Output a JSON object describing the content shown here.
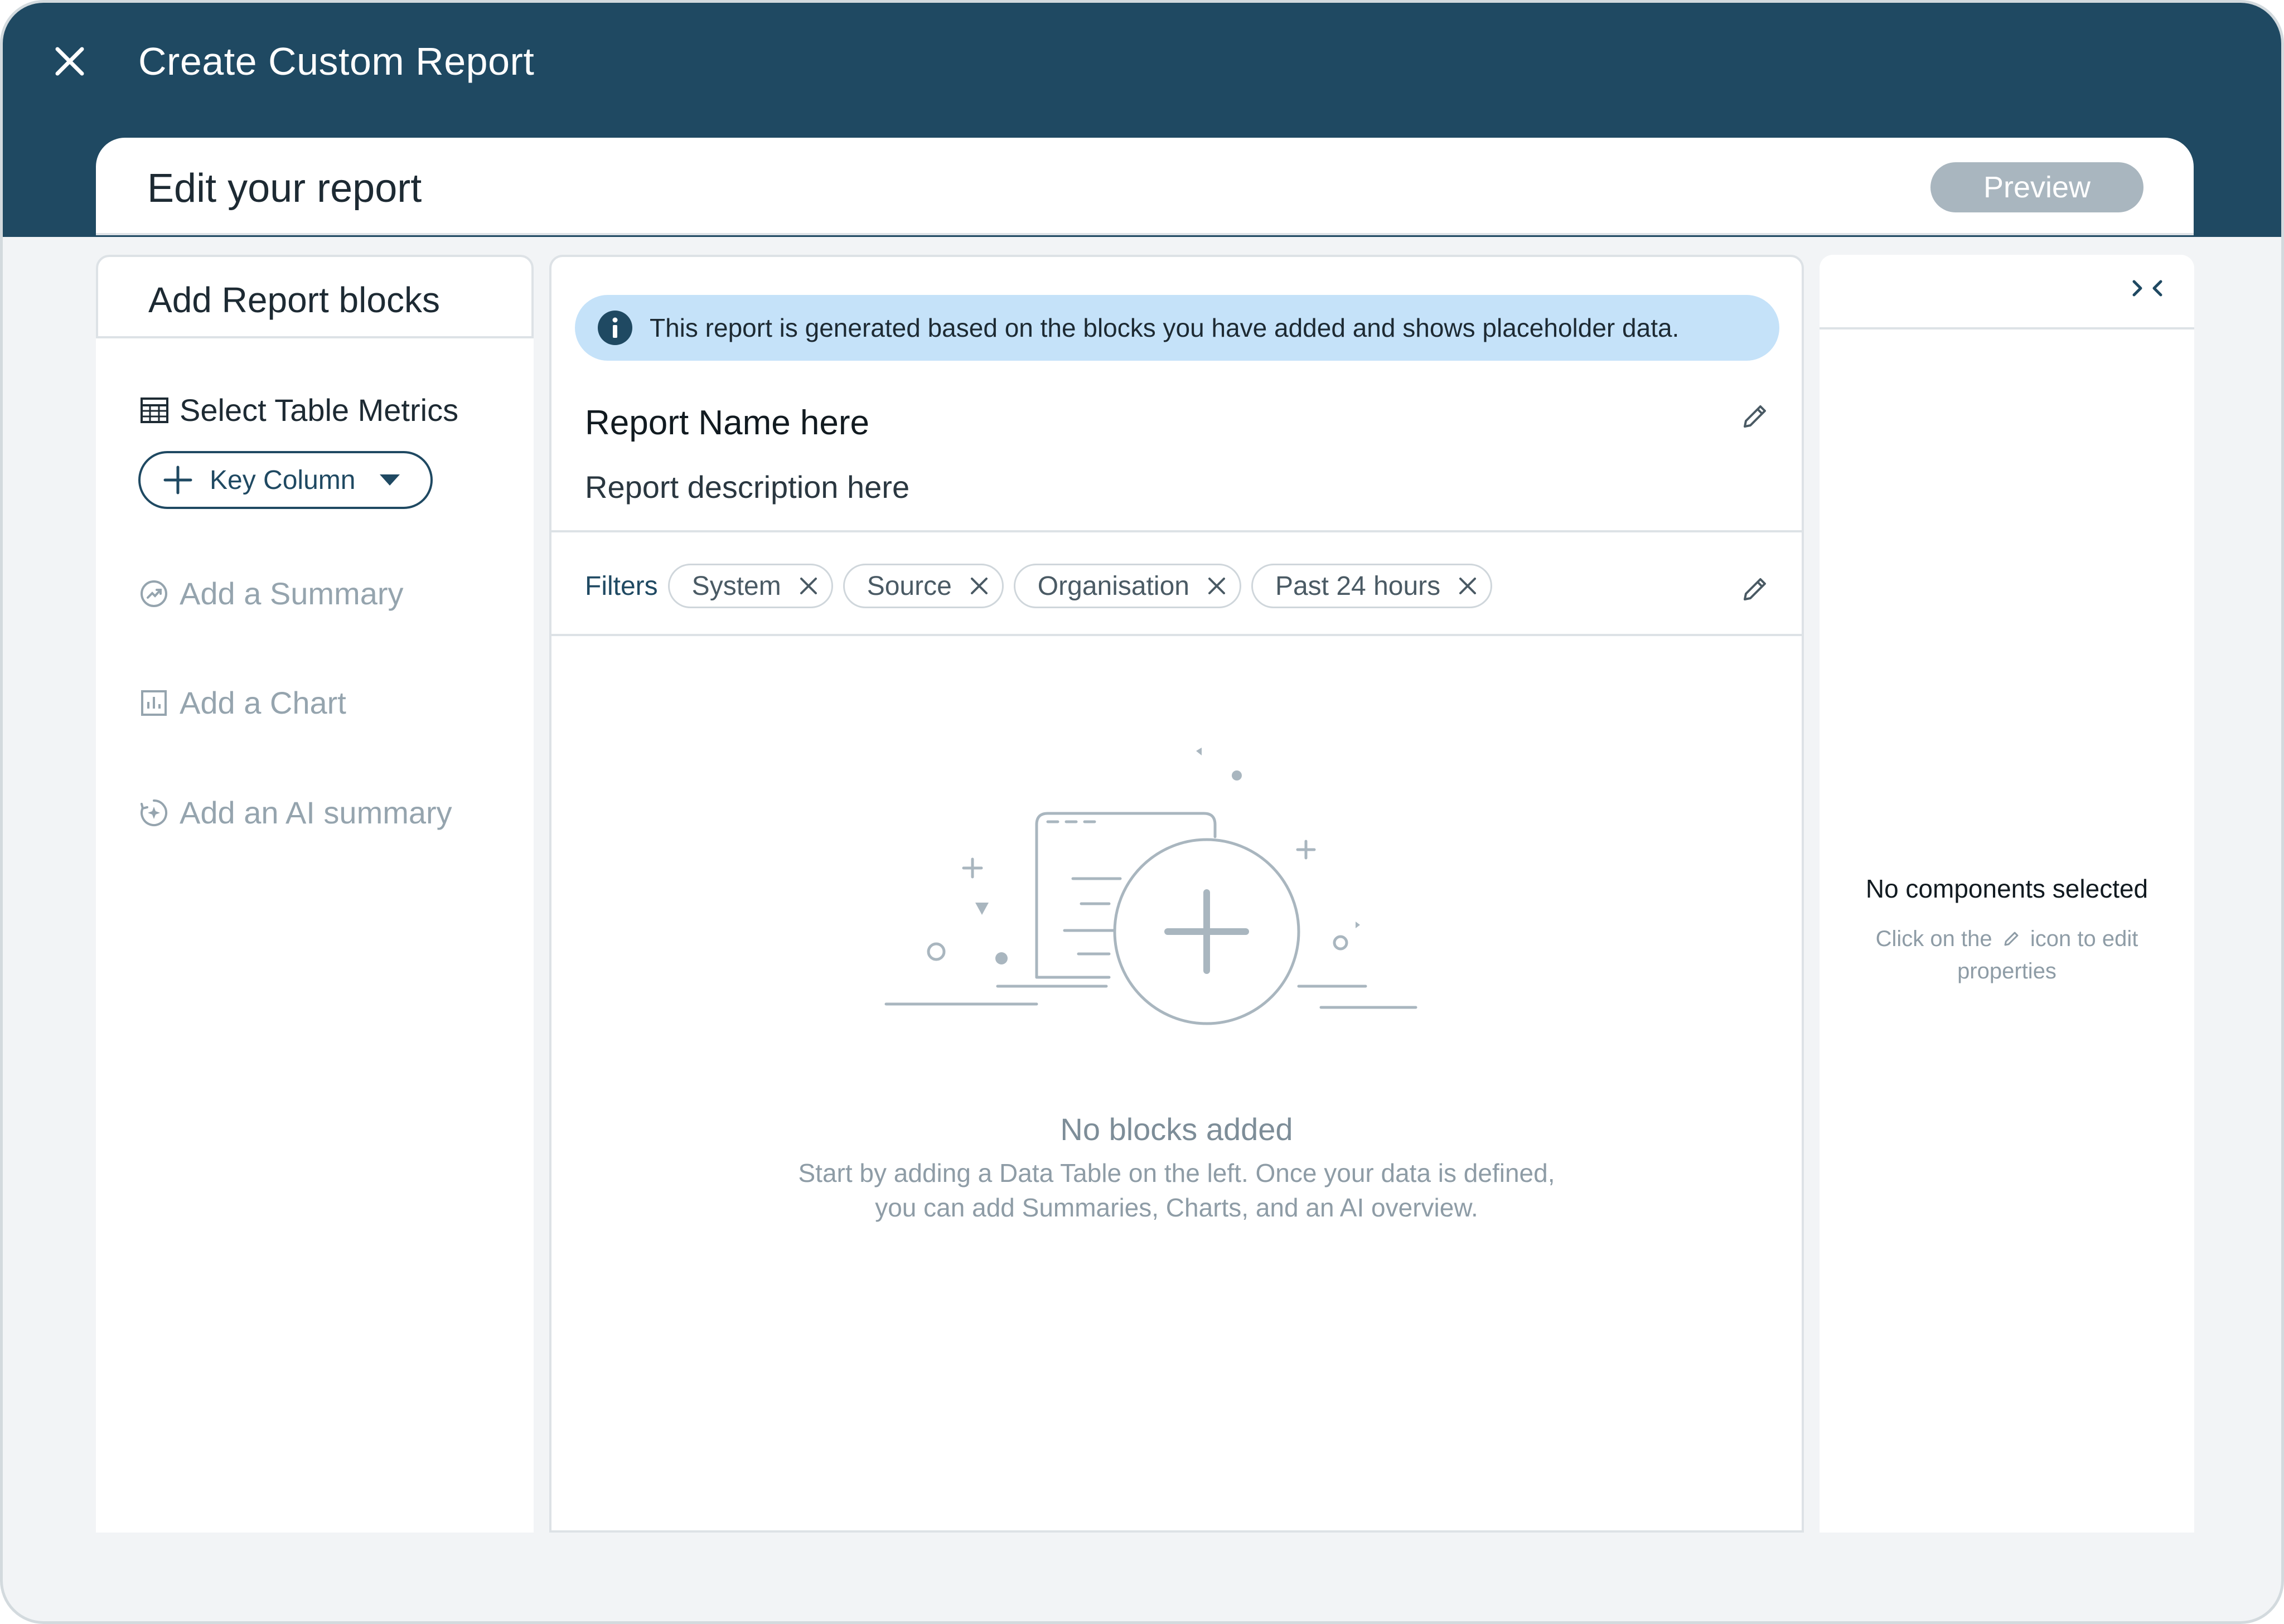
{
  "window": {
    "title": "Create Custom Report"
  },
  "editor": {
    "title": "Edit your report",
    "preview_label": "Preview"
  },
  "left_panel": {
    "title": "Add Report blocks",
    "table_metrics_label": "Select Table Metrics",
    "key_column_label": "Key Column",
    "blocks": [
      {
        "label": "Add a Summary",
        "icon": "summary-icon"
      },
      {
        "label": "Add a Chart",
        "icon": "chart-icon"
      },
      {
        "label": "Add an AI summary",
        "icon": "ai-summary-icon"
      }
    ]
  },
  "center": {
    "info_text": "This report is generated based on the blocks you have added and shows placeholder data.",
    "report_name": "Report Name here",
    "report_description": "Report description here",
    "filters_label": "Filters",
    "filters": [
      "System",
      "Source",
      "Organisation",
      "Past 24 hours"
    ],
    "empty_title": "No blocks added",
    "empty_line1": "Start by adding a Data Table on the left. Once your data is defined,",
    "empty_line2": "you can add Summaries, Charts, and an AI overview."
  },
  "right_panel": {
    "empty_title": "No components selected",
    "hint_prefix": "Click on the",
    "hint_suffix": "icon to edit properties"
  },
  "colors": {
    "header_bg": "#1f4962",
    "info_bg": "#c5e2f9",
    "preview_bg": "#a9b6bf",
    "muted_text": "#95a4ae"
  }
}
